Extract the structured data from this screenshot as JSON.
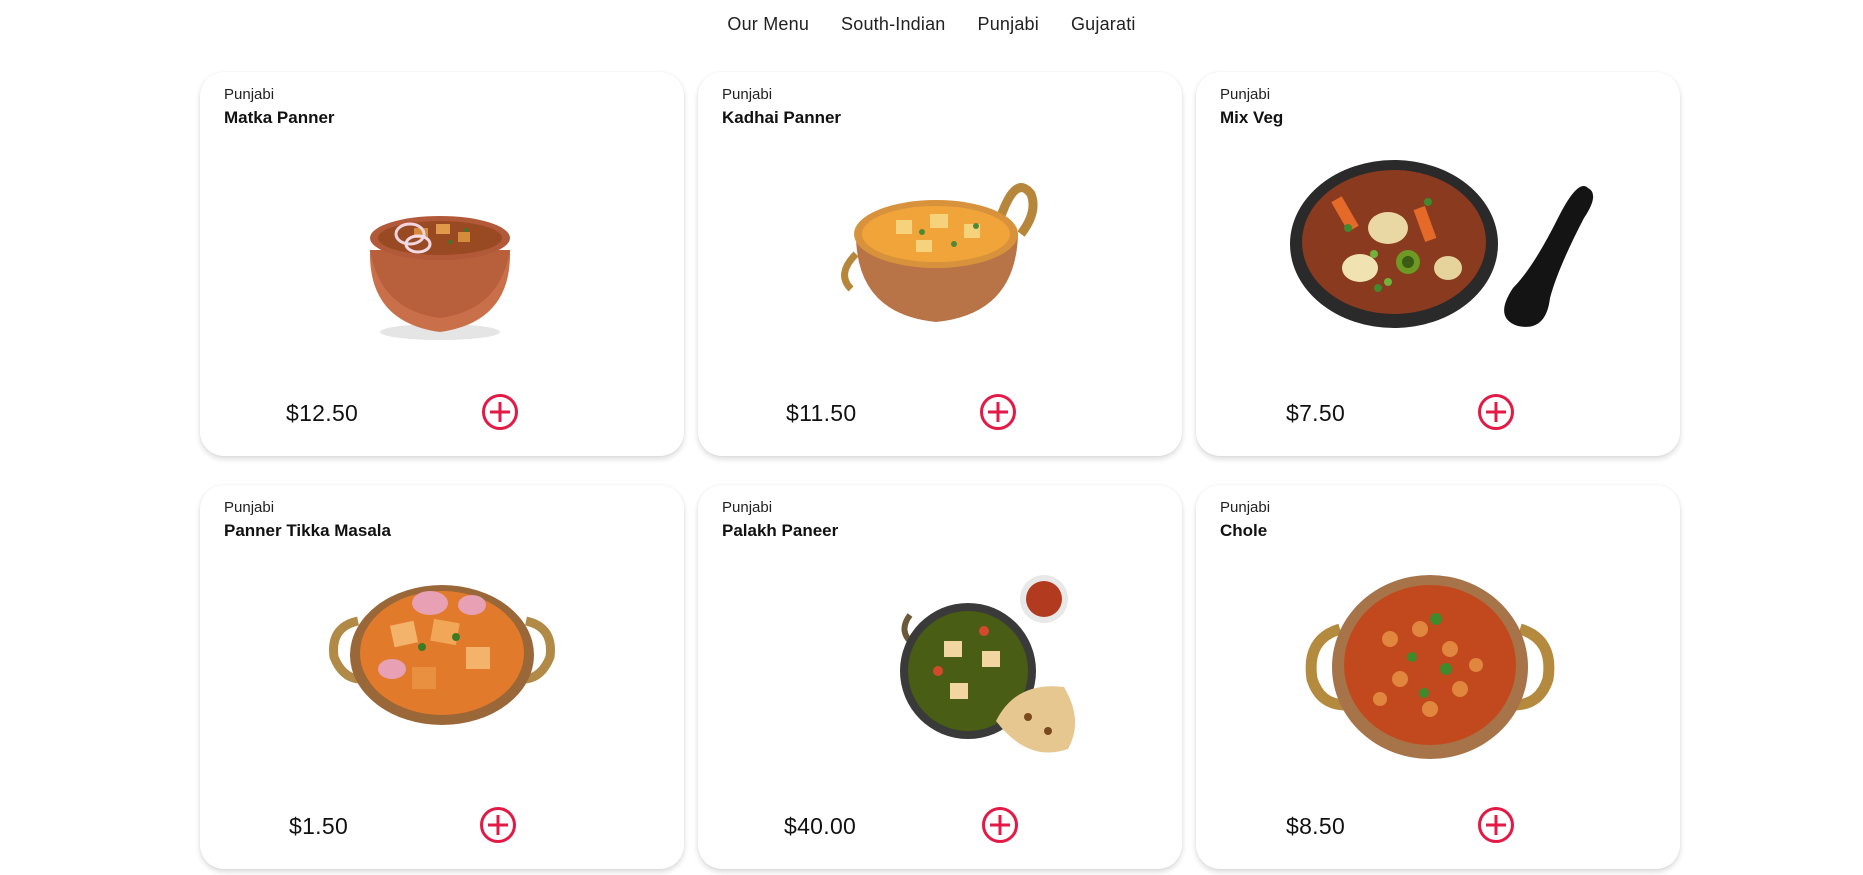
{
  "nav": {
    "items": [
      "Our Menu",
      "South-Indian",
      "Punjabi",
      "Gujarati"
    ]
  },
  "accent_color": "#e21a45",
  "items": [
    {
      "category": "Punjabi",
      "name": "Matka Panner",
      "price": "$12.50",
      "image": "matka-paneer-bowl"
    },
    {
      "category": "Punjabi",
      "name": "Kadhai Panner",
      "price": "$11.50",
      "image": "kadhai-paneer-bowl"
    },
    {
      "category": "Punjabi",
      "name": "Mix Veg",
      "price": "$7.50",
      "image": "mix-veg-bowl"
    },
    {
      "category": "Punjabi",
      "name": "Panner Tikka Masala",
      "price": "$1.50",
      "image": "paneer-tikka-masala-bowl"
    },
    {
      "category": "Punjabi",
      "name": "Palakh Paneer",
      "price": "$40.00",
      "image": "palak-paneer-bowl"
    },
    {
      "category": "Punjabi",
      "name": "Chole",
      "price": "$8.50",
      "image": "chole-bowl"
    }
  ]
}
